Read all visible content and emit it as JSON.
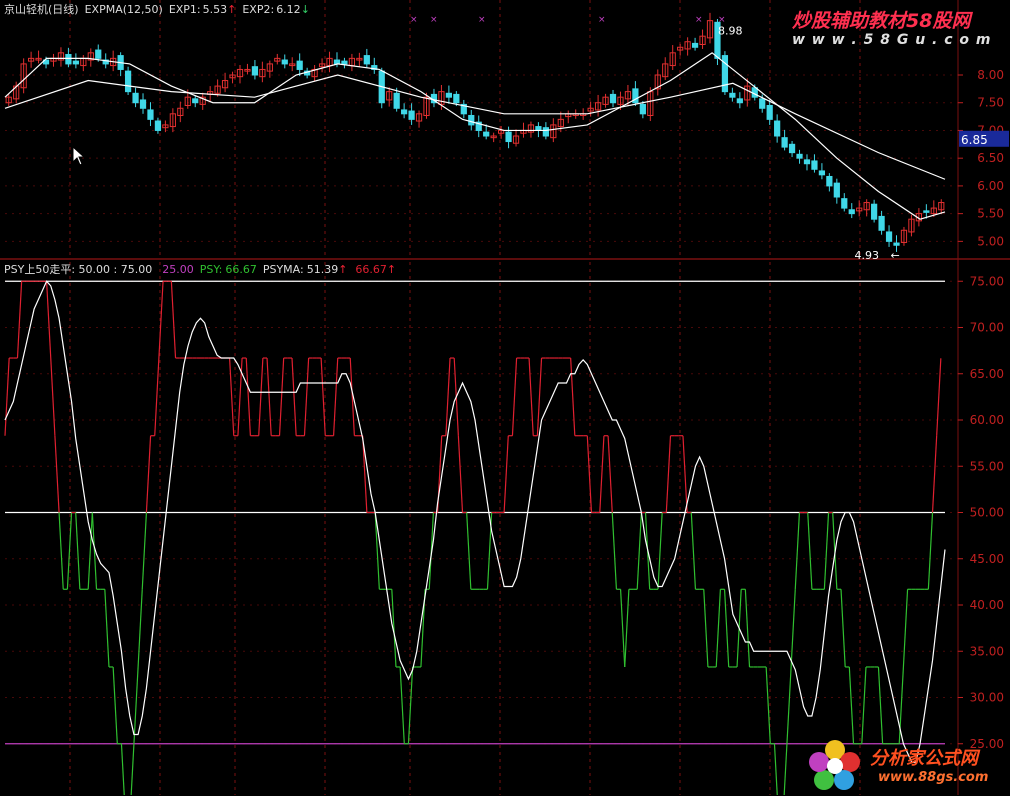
{
  "upper_panel": {
    "stock_name": "京山轻机(日线)",
    "indicator": "EXPMA(12,50)",
    "exp1_label": "EXP1:",
    "exp1_value": "5.53",
    "exp2_label": "EXP2:",
    "exp2_value": "6.12",
    "current_price_tag": "6.85",
    "high_mark": "8.98",
    "low_mark": "4.93",
    "low_arrow": "←"
  },
  "lower_panel": {
    "indicator": "PSY上50走平",
    "level_values": ": 50.00 : 75.00",
    "value_25": "25.00",
    "psy_label": "PSY:",
    "psy_value": "66.67",
    "psyma_label": "PSYMA:",
    "psyma_value": "51.39",
    "signal_value": "66.67"
  },
  "watermarks": {
    "top_title": "炒股辅助教材58股网",
    "top_url": "w w w . 5 8 G u . c o m",
    "bottom_title": "分析家公式网",
    "bottom_url": "www.88gs.com"
  },
  "colors": {
    "background": "#000000",
    "grid": "#7a1010",
    "axis_text": "#c02020",
    "up_candle": "#e23030",
    "down_candle": "#40d8e8",
    "ema": "#ffffff",
    "psy_up": "#e02030",
    "psy_down": "#30c030",
    "psyma": "#ffffff",
    "level25": "#c040c0"
  },
  "chart_data": [
    {
      "type": "candlestick",
      "title": "京山轻机(日线) EXPMA(12,50)",
      "ylim": [
        4.7,
        9.1
      ],
      "y_ticks": [
        "8.00",
        "7.50",
        "7.00",
        "6.50",
        "6.00",
        "5.50",
        "5.00"
      ],
      "series": [
        {
          "name": "EXP1",
          "x": [
            0,
            10,
            20,
            30,
            40,
            50,
            60,
            70,
            80,
            90,
            100,
            110,
            120,
            130,
            140,
            150,
            160,
            170,
            180,
            190,
            200,
            210,
            220,
            226
          ],
          "values": [
            7.6,
            8.3,
            8.3,
            8.2,
            7.8,
            7.5,
            7.5,
            8.0,
            8.2,
            8.1,
            7.7,
            7.2,
            7.0,
            7.0,
            7.1,
            7.5,
            7.9,
            8.4,
            7.8,
            7.2,
            6.5,
            5.9,
            5.4,
            5.53
          ]
        },
        {
          "name": "EXP2",
          "x": [
            0,
            20,
            40,
            60,
            80,
            100,
            120,
            140,
            160,
            175,
            190,
            210,
            226
          ],
          "values": [
            7.4,
            7.9,
            7.7,
            7.6,
            8.0,
            7.6,
            7.3,
            7.3,
            7.6,
            7.85,
            7.3,
            6.6,
            6.12
          ]
        }
      ],
      "close": [
        7.6,
        7.8,
        8.2,
        8.3,
        8.3,
        8.2,
        8.3,
        8.4,
        8.2,
        8.2,
        8.3,
        8.4,
        8.3,
        8.2,
        8.3,
        8.1,
        7.7,
        7.5,
        7.4,
        7.2,
        7.0,
        7.1,
        7.3,
        7.4,
        7.6,
        7.5,
        7.6,
        7.7,
        7.8,
        7.9,
        8.0,
        8.1,
        8.1,
        8.0,
        8.1,
        8.2,
        8.3,
        8.2,
        8.2,
        8.1,
        8.0,
        8.1,
        8.2,
        8.3,
        8.2,
        8.2,
        8.3,
        8.3,
        8.2,
        8.1,
        7.5,
        7.7,
        7.4,
        7.3,
        7.2,
        7.3,
        7.6,
        7.5,
        7.7,
        7.6,
        7.5,
        7.3,
        7.1,
        7.0,
        6.9,
        6.9,
        7.0,
        6.8,
        6.9,
        7.0,
        7.1,
        7.0,
        6.9,
        7.1,
        7.2,
        7.3,
        7.3,
        7.3,
        7.4,
        7.5,
        7.6,
        7.5,
        7.6,
        7.7,
        7.5,
        7.3,
        7.7,
        8.0,
        8.2,
        8.4,
        8.5,
        8.6,
        8.5,
        8.7,
        8.98,
        8.3,
        7.7,
        7.6,
        7.5,
        7.8,
        7.6,
        7.4,
        7.2,
        6.9,
        6.7,
        6.6,
        6.5,
        6.4,
        6.3,
        6.2,
        6.0,
        5.8,
        5.6,
        5.5,
        5.6,
        5.7,
        5.4,
        5.2,
        5.0,
        4.93,
        5.2,
        5.4,
        5.5,
        5.53,
        5.6,
        5.7
      ],
      "high": 8.98,
      "low": 4.93
    },
    {
      "type": "line",
      "title": "PSY上50走平",
      "ylim": [
        20,
        76
      ],
      "y_ticks": [
        "75.00",
        "70.00",
        "65.00",
        "60.00",
        "55.00",
        "50.00",
        "45.00",
        "40.00",
        "35.00",
        "30.00",
        "25.00"
      ],
      "levels": [
        75,
        50,
        25
      ],
      "x": [
        0,
        1,
        2,
        3,
        4,
        5,
        6,
        7,
        8,
        9,
        10,
        11,
        12,
        13,
        14,
        15,
        16,
        17,
        18,
        19,
        20,
        21,
        22,
        23,
        24,
        25,
        26,
        27,
        28,
        29,
        30,
        31,
        32,
        33,
        34,
        35,
        36,
        37,
        38,
        39,
        40,
        41,
        42,
        43,
        44,
        45,
        46,
        47,
        48,
        49,
        50,
        51,
        52,
        53,
        54,
        55,
        56,
        57,
        58,
        59,
        60,
        61,
        62,
        63,
        64,
        65,
        66,
        67,
        68,
        69,
        70,
        71,
        72,
        73,
        74,
        75,
        76,
        77,
        78,
        79,
        80,
        81,
        82,
        83,
        84,
        85,
        86,
        87,
        88,
        89,
        90,
        91,
        92,
        93,
        94,
        95,
        96,
        97,
        98,
        99,
        100,
        101,
        102,
        103,
        104,
        105,
        106,
        107,
        108,
        109,
        110,
        111,
        112,
        113,
        114,
        115,
        116,
        117,
        118,
        119,
        120,
        121,
        122,
        123,
        124,
        125,
        126,
        127,
        128,
        129,
        130,
        131,
        132,
        133,
        134,
        135,
        136,
        137,
        138,
        139,
        140,
        141,
        142,
        143,
        144,
        145,
        146,
        147,
        148,
        149,
        150,
        151,
        152,
        153,
        154,
        155,
        156,
        157,
        158,
        159,
        160,
        161,
        162,
        163,
        164,
        165,
        166,
        167,
        168,
        169,
        170,
        171,
        172,
        173,
        174,
        175,
        176,
        177,
        178,
        179,
        180,
        181,
        182,
        183,
        184,
        185,
        186,
        187,
        188,
        189,
        190,
        191,
        192,
        193,
        194,
        195,
        196,
        197,
        198,
        199,
        200,
        201,
        202,
        203,
        204,
        205,
        206,
        207,
        208,
        209,
        210,
        211,
        212,
        213,
        214,
        215,
        216,
        217,
        218,
        219,
        220,
        221,
        222,
        223,
        224,
        225,
        226
      ],
      "series": [
        {
          "name": "PSY",
          "values": [
            58.3,
            66.7,
            66.7,
            66.7,
            75,
            75,
            75,
            75,
            75,
            75,
            75,
            66.7,
            58.3,
            50,
            41.7,
            41.7,
            50,
            50,
            41.7,
            41.7,
            41.7,
            50,
            41.7,
            41.7,
            41.7,
            33.3,
            33.3,
            25,
            25,
            16.7,
            16.7,
            25,
            33.3,
            41.7,
            50,
            58.3,
            58.3,
            66.7,
            75,
            75,
            75,
            66.7,
            66.7,
            66.7,
            66.7,
            66.7,
            66.7,
            66.7,
            66.7,
            66.7,
            66.7,
            66.7,
            66.7,
            66.7,
            66.7,
            58.3,
            58.3,
            66.7,
            66.7,
            58.3,
            58.3,
            58.3,
            66.7,
            66.7,
            58.3,
            58.3,
            58.3,
            66.7,
            66.7,
            66.7,
            58.3,
            58.3,
            58.3,
            66.7,
            66.7,
            66.7,
            66.7,
            58.3,
            58.3,
            58.3,
            66.7,
            66.7,
            66.7,
            66.7,
            58.3,
            58.3,
            58.3,
            50,
            50,
            50,
            41.7,
            41.7,
            41.7,
            41.7,
            33.3,
            33.3,
            25,
            25,
            33.3,
            33.3,
            33.3,
            41.7,
            41.7,
            50,
            50,
            58.3,
            58.3,
            66.7,
            66.7,
            58.3,
            50,
            50,
            41.7,
            41.7,
            41.7,
            41.7,
            41.7,
            50,
            50,
            50,
            50,
            58.3,
            58.3,
            66.7,
            66.7,
            66.7,
            66.7,
            58.3,
            58.3,
            66.7,
            66.7,
            66.7,
            66.7,
            66.7,
            66.7,
            66.7,
            66.7,
            58.3,
            58.3,
            58.3,
            58.3,
            50,
            50,
            50,
            58.3,
            58.3,
            50,
            41.7,
            41.7,
            33.3,
            41.7,
            41.7,
            41.7,
            50,
            50,
            41.7,
            41.7,
            41.7,
            50,
            50,
            58.3,
            58.3,
            58.3,
            58.3,
            50,
            50,
            41.7,
            41.7,
            41.7,
            33.3,
            33.3,
            33.3,
            41.7,
            41.7,
            33.3,
            33.3,
            33.3,
            41.7,
            41.7,
            33.3,
            33.3,
            33.3,
            33.3,
            33.3,
            25,
            25,
            16.7,
            16.7,
            25,
            33.3,
            41.7,
            50,
            50,
            50,
            41.7,
            41.7,
            41.7,
            41.7,
            50,
            50,
            41.7,
            41.7,
            33.3,
            33.3,
            25,
            25,
            25,
            33.3,
            33.3,
            33.3,
            33.3,
            25,
            25,
            25,
            25,
            25,
            33.3,
            41.7,
            41.7,
            41.7,
            41.7,
            41.7,
            41.7,
            50,
            58.3,
            66.67
          ]
        },
        {
          "name": "PSYMA",
          "values": [
            60,
            61,
            62,
            64,
            66,
            68,
            70,
            72,
            73,
            74,
            75,
            74.5,
            73,
            71,
            68,
            65,
            62,
            58,
            55,
            52,
            49,
            47,
            45.5,
            44.5,
            44,
            43.5,
            41,
            38,
            35,
            31,
            28,
            26,
            26,
            28,
            31,
            35,
            39,
            43,
            47,
            51,
            55,
            59,
            63,
            66,
            68,
            69.5,
            70.5,
            71,
            70.5,
            69,
            68,
            67,
            66.7,
            66.7,
            66.7,
            66.7,
            66,
            65,
            64,
            63,
            63,
            63,
            63,
            63,
            63,
            63,
            63,
            63,
            63,
            63,
            63,
            64,
            64,
            64,
            64,
            64,
            64,
            64,
            64,
            64,
            64,
            65,
            65,
            64,
            62,
            60,
            58,
            55,
            52,
            50,
            47,
            44,
            41,
            38,
            36,
            34,
            33,
            32,
            33,
            35,
            38,
            41,
            44,
            47,
            51,
            54,
            57,
            60,
            62,
            63,
            64,
            63,
            62,
            60,
            57,
            54,
            51,
            48,
            46,
            44,
            42,
            42,
            42,
            43,
            45,
            48,
            51,
            54,
            57,
            60,
            61,
            62,
            63,
            64,
            64,
            64,
            65,
            65,
            66,
            66.5,
            66,
            65,
            64,
            63,
            62,
            61,
            60,
            60,
            59,
            58,
            56,
            54,
            52,
            50,
            47,
            45,
            43,
            42,
            42,
            43,
            44,
            45,
            47,
            49,
            51,
            53,
            55,
            56,
            55,
            53,
            51,
            49,
            47,
            45,
            42,
            39,
            38,
            37,
            36,
            36,
            35,
            35,
            35,
            35,
            35,
            35,
            35,
            35,
            35,
            34,
            33,
            31,
            29,
            28,
            28,
            30,
            33,
            37,
            41,
            44,
            47,
            49,
            50,
            50,
            49,
            47,
            45,
            43,
            41,
            39,
            37,
            35,
            33,
            31,
            29,
            27,
            25,
            24,
            23,
            23,
            25,
            28,
            31,
            34,
            38,
            42,
            46,
            50,
            51.39
          ]
        }
      ]
    }
  ]
}
